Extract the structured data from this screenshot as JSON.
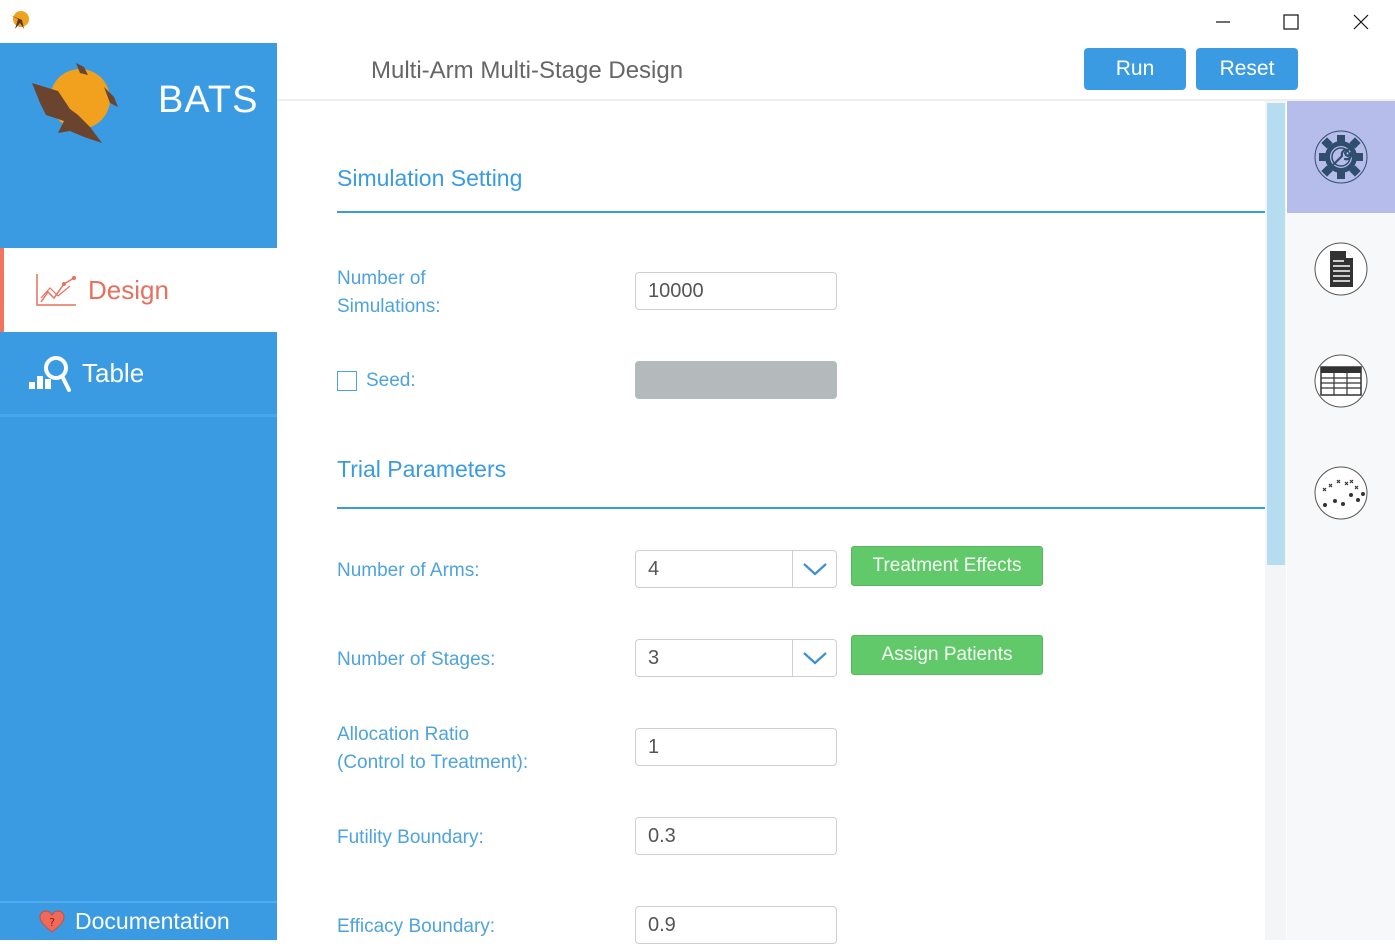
{
  "window": {
    "minimize_icon": "minimize-icon",
    "maximize_icon": "maximize-icon",
    "close_icon": "close-icon"
  },
  "brand": {
    "name": "BATS",
    "logo": "bat-moon-logo"
  },
  "sidebar": {
    "items": [
      {
        "label": "Design",
        "icon": "line-chart-icon",
        "active": true
      },
      {
        "label": "Table",
        "icon": "bar-search-icon",
        "active": false
      }
    ],
    "footer": {
      "label": "Documentation",
      "icon": "heart-question-icon"
    }
  },
  "header": {
    "title": "Multi-Arm Multi-Stage Design",
    "run_label": "Run",
    "reset_label": "Reset"
  },
  "sections": {
    "simulation": {
      "title": "Simulation Setting",
      "num_sims_label_line1": "Number of",
      "num_sims_label_line2": "Simulations:",
      "num_sims_value": "10000",
      "seed_label": "Seed:",
      "seed_checked": false,
      "seed_value": ""
    },
    "trial": {
      "title": "Trial Parameters",
      "arms_label": "Number of Arms:",
      "arms_value": "4",
      "treatment_effects_label": "Treatment Effects",
      "stages_label": "Number of Stages:",
      "stages_value": "3",
      "assign_patients_label": "Assign Patients",
      "allocation_label_line1": "Allocation Ratio",
      "allocation_label_line2": "(Control to Treatment):",
      "allocation_value": "1",
      "futility_label": "Futility Boundary:",
      "futility_value": "0.3",
      "efficacy_label": "Efficacy Boundary:",
      "efficacy_value": "0.9"
    }
  },
  "rightbar": {
    "items": [
      {
        "icon": "settings-wrench-icon",
        "active": true
      },
      {
        "icon": "document-icon",
        "active": false
      },
      {
        "icon": "table-icon",
        "active": false
      },
      {
        "icon": "scatter-plot-icon",
        "active": false
      }
    ]
  },
  "colors": {
    "primary": "#3a9be3",
    "accent": "#e8705e",
    "success": "#62c96a",
    "active_tab": "#b6bdea"
  }
}
